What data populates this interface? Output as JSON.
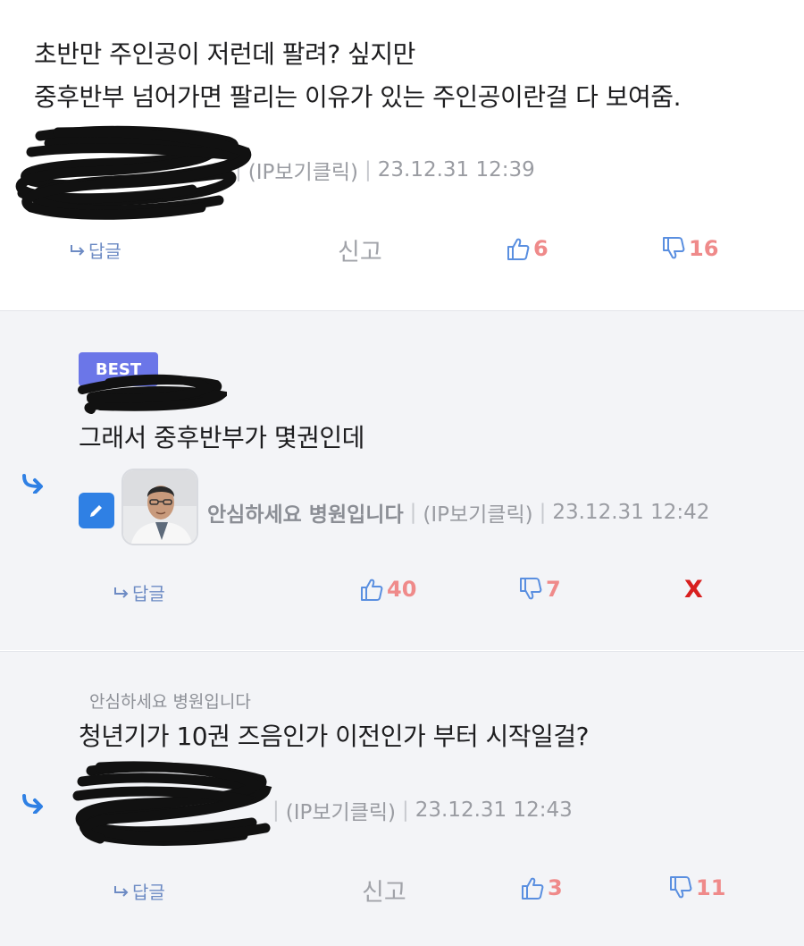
{
  "comments": [
    {
      "text_line1": "초반만 주인공이 저런데 팔려? 싶지만",
      "text_line2": "중후반부 넘어가면 팔리는 이유가 있는 주인공이란걸 다 보여줌.",
      "ip_label": "(IP보기클릭)",
      "timestamp": "23.12.31 12:39",
      "reply_label": "답글",
      "report_label": "신고",
      "upvotes": "6",
      "downvotes": "16"
    },
    {
      "badge": "BEST",
      "text": "그래서 중후반부가 몇권인데",
      "nickname": "안심하세요 병원입니다",
      "ip_label": "(IP보기클릭)",
      "timestamp": "23.12.31 12:42",
      "reply_label": "답글",
      "upvotes": "40",
      "downvotes": "7",
      "delete_label": "X"
    },
    {
      "reply_to": "안심하세요 병원입니다",
      "text": "청년기가 10권 즈음인가 이전인가 부터 시작일걸?",
      "ip_label": "(IP보기클릭)",
      "timestamp": "23.12.31 12:43",
      "reply_label": "답글",
      "report_label": "신고",
      "upvotes": "3",
      "downvotes": "11"
    }
  ],
  "colors": {
    "badge": "#6b76e8",
    "accent_blue": "#2f80e4",
    "vote": "#ef8a8a",
    "delete": "#d81f1f",
    "reply_bg": "#f3f4f7"
  },
  "icons": [
    "reply-arrow-icon",
    "thumbs-up-icon",
    "thumbs-down-icon",
    "reply-indent-arrow-icon",
    "pencil-icon"
  ]
}
